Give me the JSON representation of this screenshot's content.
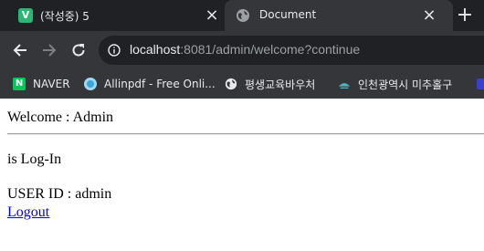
{
  "browser": {
    "tabs": [
      {
        "title": "(작성중) 5",
        "favicon": "v-letter-icon",
        "favicon_letter": "V",
        "active": false
      },
      {
        "title": "Document",
        "favicon": "globe-icon",
        "active": true
      }
    ],
    "url_host": "localhost",
    "url_rest": ":8081/admin/welcome?continue",
    "bookmarks": [
      {
        "label": "NAVER",
        "icon": "naver-icon",
        "color": "#03c75a"
      },
      {
        "label": "Allinpdf - Free Onli...",
        "icon": "allinpdf-icon",
        "color": "#3aa6dd"
      },
      {
        "label": "평생교육바우처",
        "icon": "globe-icon",
        "color": "#e8eaed"
      },
      {
        "label": "인천광역시 미추홀구",
        "icon": "incheon-icon",
        "color": "#4fb3bf"
      }
    ]
  },
  "page": {
    "welcome": "Welcome : Admin",
    "status": "is Log-In",
    "user_id": "USER ID : admin",
    "logout": "Logout"
  }
}
